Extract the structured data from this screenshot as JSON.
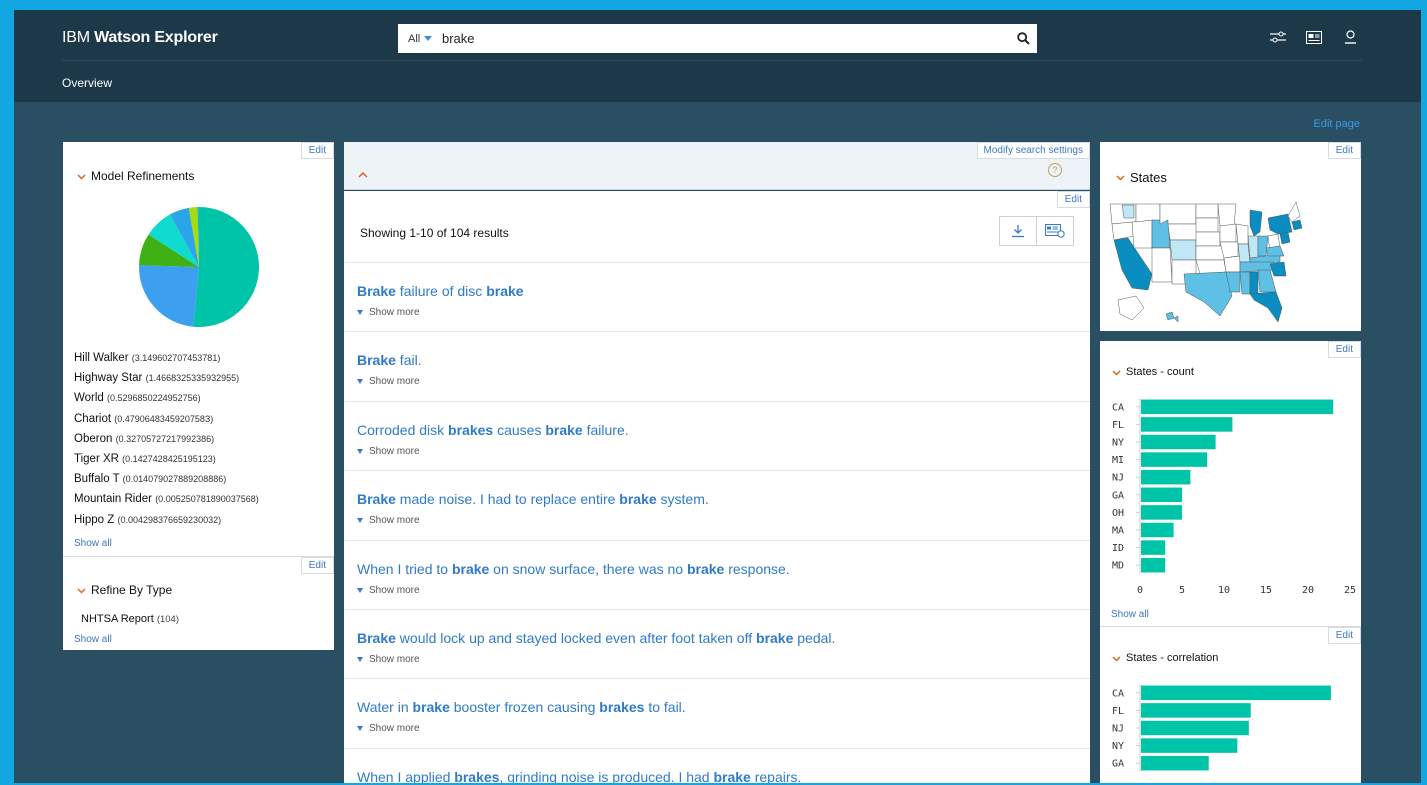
{
  "app": {
    "brand_prefix": "IBM",
    "brand_name": "Watson Explorer"
  },
  "search": {
    "scope": "All",
    "query": "brake"
  },
  "header_icons": [
    "sliders-icon",
    "dashboard-icon",
    "user-icon"
  ],
  "nav": {
    "overview": "Overview",
    "edit_page": "Edit page"
  },
  "edit_label": "Edit",
  "model_refinements": {
    "title": "Model Refinements",
    "items": [
      {
        "name": "Hill Walker",
        "score": "(3.149602707453781)",
        "color": "#00c4a7"
      },
      {
        "name": "Highway Star",
        "score": "(1.4668325335932955)",
        "color": "#3d9fef"
      },
      {
        "name": "World",
        "score": "(0.5296850224952756)",
        "color": "#3fb115"
      },
      {
        "name": "Chariot",
        "score": "(0.4790648345920758З)",
        "color": "#0fdbd1"
      },
      {
        "name": "Oberon",
        "score": "(0.32705727217992386)",
        "color": "#2aa6e8"
      },
      {
        "name": "Tiger XR",
        "score": "(0.1427428425195123)",
        "color": "#a4dd10"
      },
      {
        "name": "Buffalo T",
        "score": "(0.014079027889208886)",
        "color": "#0a8ec2"
      },
      {
        "name": "Mountain Rider",
        "score": "(0.005250781890037568)",
        "color": "#7cc8ff"
      },
      {
        "name": "Hippo Z",
        "score": "(0.004298376659230032)",
        "color": "#00977f"
      }
    ],
    "pie_values": [
      3.149602707453781,
      1.4668325335932955,
      0.5296850224952756,
      0.47906483459207583,
      0.32705727217992386,
      0.1427428425195123,
      0.014079027889208886,
      0.005250781890037568,
      0.004298376659230032
    ],
    "show_all": "Show all"
  },
  "refine_by_type": {
    "title": "Refine By Type",
    "item": "NHTSA Report",
    "count": "(104)",
    "show_all": "Show all"
  },
  "search_settings": {
    "modify": "Modify search settings",
    "help": "?"
  },
  "results": {
    "summary": "Showing 1-10 of 104 results",
    "show_more": "Show more",
    "items": [
      [
        [
          "b",
          "Brake"
        ],
        [
          "t",
          " failure of disc "
        ],
        [
          "b",
          "brake"
        ]
      ],
      [
        [
          "b",
          "Brake"
        ],
        [
          "t",
          " fail."
        ]
      ],
      [
        [
          "t",
          "Corroded disk "
        ],
        [
          "b",
          "brakes"
        ],
        [
          "t",
          " causes "
        ],
        [
          "b",
          "brake"
        ],
        [
          "t",
          " failure."
        ]
      ],
      [
        [
          "b",
          "Brake"
        ],
        [
          "t",
          " made noise. I had to replace entire "
        ],
        [
          "b",
          "brake"
        ],
        [
          "t",
          " system."
        ]
      ],
      [
        [
          "t",
          "When I tried to "
        ],
        [
          "b",
          "brake"
        ],
        [
          "t",
          " on snow surface, there was no "
        ],
        [
          "b",
          "brake"
        ],
        [
          "t",
          " response."
        ]
      ],
      [
        [
          "b",
          "Brake"
        ],
        [
          "t",
          " would lock up and stayed locked even after foot taken off "
        ],
        [
          "b",
          "brake"
        ],
        [
          "t",
          " pedal."
        ]
      ],
      [
        [
          "t",
          "Water in "
        ],
        [
          "b",
          "brake"
        ],
        [
          "t",
          " booster frozen causing "
        ],
        [
          "b",
          "brakes"
        ],
        [
          "t",
          " to fail."
        ]
      ],
      [
        [
          "t",
          "When I applied "
        ],
        [
          "b",
          "brakes"
        ],
        [
          "t",
          ", grinding noise is produced. I had "
        ],
        [
          "b",
          "brake"
        ],
        [
          "t",
          " repairs."
        ]
      ]
    ]
  },
  "states_map": {
    "title": "States",
    "fill_dark": "#0a8ec2",
    "fill_mid": "#5ec0e4",
    "fill_light": "#bfe7f5"
  },
  "chart_data": [
    {
      "type": "bar",
      "orientation": "horizontal",
      "title": "States - count",
      "categories": [
        "CA",
        "FL",
        "NY",
        "MI",
        "NJ",
        "GA",
        "OH",
        "MA",
        "ID",
        "MD"
      ],
      "values": [
        23,
        11,
        9,
        8,
        6,
        5,
        5,
        4,
        3,
        3
      ],
      "xlim": [
        0,
        25
      ],
      "xticks": [
        0,
        5,
        10,
        15,
        20,
        25
      ],
      "color": "#00c4a7",
      "show_all": "Show all"
    },
    {
      "type": "bar",
      "orientation": "horizontal",
      "title": "States - correlation",
      "categories": [
        "CA",
        "FL",
        "NJ",
        "NY",
        "GA"
      ],
      "values": [
        1.0,
        0.58,
        0.57,
        0.51,
        0.36
      ],
      "xlim": [
        0,
        1.1
      ],
      "color": "#00c4a7"
    }
  ]
}
